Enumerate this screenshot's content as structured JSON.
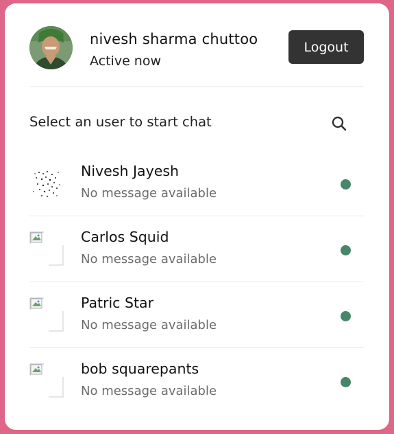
{
  "header": {
    "user_name": "nivesh sharma chuttoo",
    "status": "Active now",
    "logout_label": "Logout"
  },
  "search": {
    "prompt": "Select an user to start chat",
    "icon": "search-icon"
  },
  "users": [
    {
      "name": "Nivesh Jayesh",
      "message": "No message available",
      "status_color": "#468669"
    },
    {
      "name": "Carlos Squid",
      "message": "No message available",
      "status_color": "#468669"
    },
    {
      "name": "Patric Star",
      "message": "No message available",
      "status_color": "#468669"
    },
    {
      "name": "bob squarepants",
      "message": "No message available",
      "status_color": "#468669"
    }
  ],
  "colors": {
    "page_background": "#df6688",
    "card_background": "#ffffff",
    "logout_button": "#333333",
    "online_status": "#468669"
  }
}
